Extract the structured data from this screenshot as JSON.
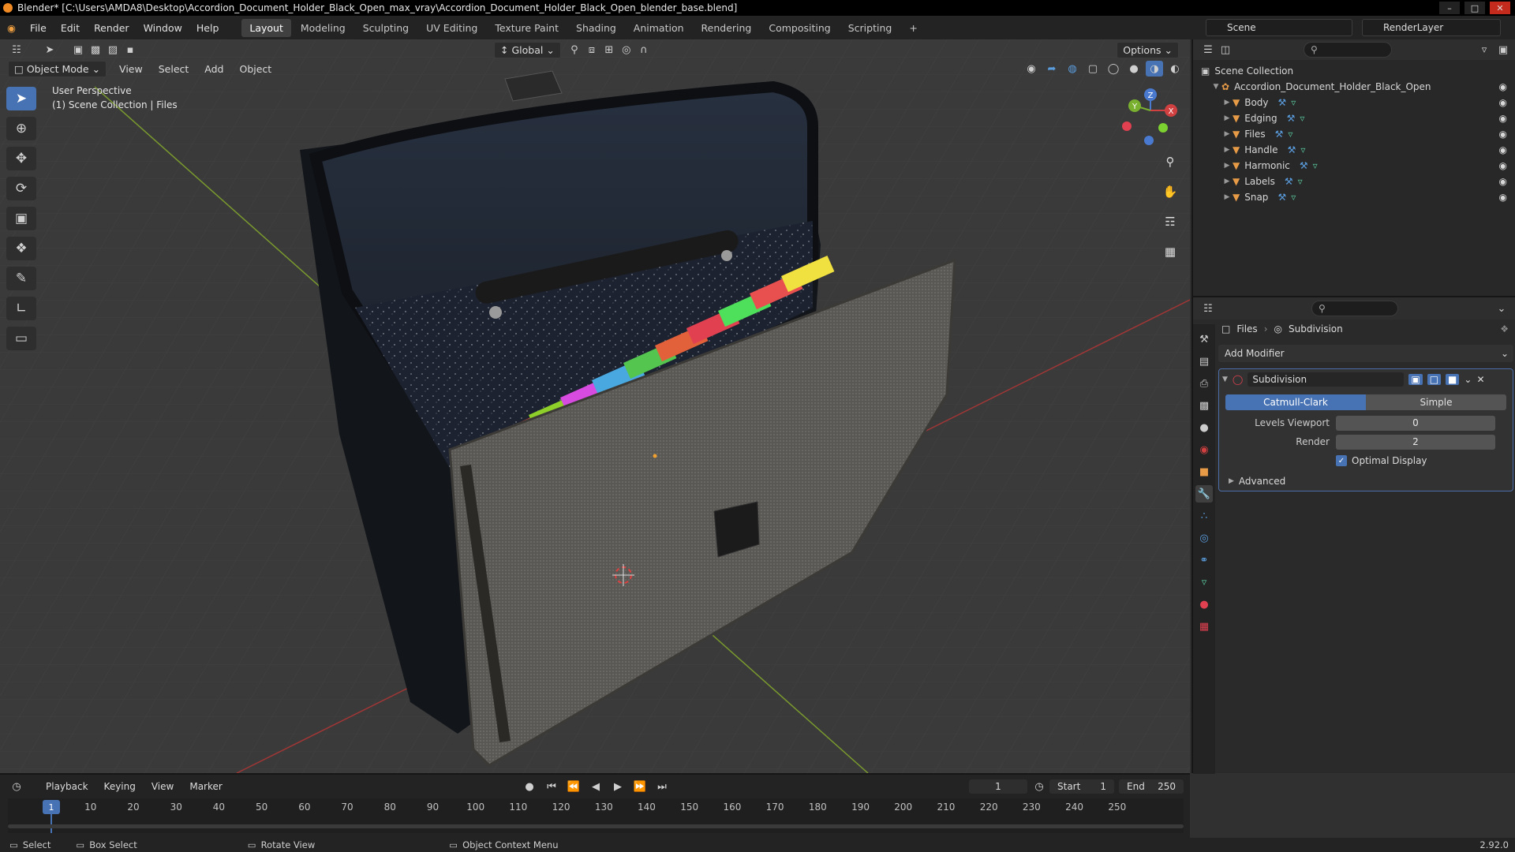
{
  "window": {
    "title": "Blender* [C:\\Users\\AMDA8\\Desktop\\Accordion_Document_Holder_Black_Open_max_vray\\Accordion_Document_Holder_Black_Open_blender_base.blend]"
  },
  "menu": [
    "File",
    "Edit",
    "Render",
    "Window",
    "Help"
  ],
  "workspaces": [
    "Layout",
    "Modeling",
    "Sculpting",
    "UV Editing",
    "Texture Paint",
    "Shading",
    "Animation",
    "Rendering",
    "Compositing",
    "Scripting"
  ],
  "active_workspace": "Layout",
  "scene": {
    "name": "Scene",
    "render_layer": "RenderLayer"
  },
  "viewport": {
    "mode": "Object Mode",
    "menus": [
      "View",
      "Select",
      "Add",
      "Object"
    ],
    "transform_orientation": "Global",
    "options_label": "Options",
    "perspective_label": "User Perspective",
    "collection_label": "(1) Scene Collection | Files",
    "gizmo_axes": [
      "Z",
      "Y",
      "X"
    ]
  },
  "outliner": {
    "root": "Scene Collection",
    "collection": "Accordion_Document_Holder_Black_Open",
    "objects": [
      "Body",
      "Edging",
      "Files",
      "Handle",
      "Harmonic",
      "Labels",
      "Snap"
    ]
  },
  "properties": {
    "breadcrumb_object": "Files",
    "breadcrumb_modifier": "Subdivision",
    "add_modifier": "Add Modifier",
    "modifier_name": "Subdivision",
    "algorithms": [
      "Catmull-Clark",
      "Simple"
    ],
    "active_algorithm": "Catmull-Clark",
    "levels_viewport_label": "Levels Viewport",
    "levels_viewport": "0",
    "render_label": "Render",
    "render": "2",
    "optimal_display_label": "Optimal Display",
    "optimal_display": true,
    "advanced_label": "Advanced"
  },
  "timeline": {
    "menus": [
      "Playback",
      "Keying",
      "View",
      "Marker"
    ],
    "current_frame": "1",
    "start_label": "Start",
    "start": "1",
    "end_label": "End",
    "end": "250",
    "ticks": [
      "1",
      "10",
      "20",
      "30",
      "40",
      "50",
      "60",
      "70",
      "80",
      "90",
      "100",
      "110",
      "120",
      "130",
      "140",
      "150",
      "160",
      "170",
      "180",
      "190",
      "200",
      "210",
      "220",
      "230",
      "240",
      "250"
    ]
  },
  "statusbar": {
    "items": [
      "Select",
      "Box Select",
      "Rotate View",
      "Object Context Menu"
    ],
    "version": "2.92.0"
  },
  "colors": {
    "accent": "#4772b3",
    "mesh_icon": "#e79b47",
    "tab_colors": [
      "#3b6fd6",
      "#e0463e",
      "#8fcf2a",
      "#d84be0",
      "#49a8e0",
      "#54c650",
      "#e2603a",
      "#e04050",
      "#4ee05a",
      "#e85050",
      "#f0e040"
    ]
  }
}
